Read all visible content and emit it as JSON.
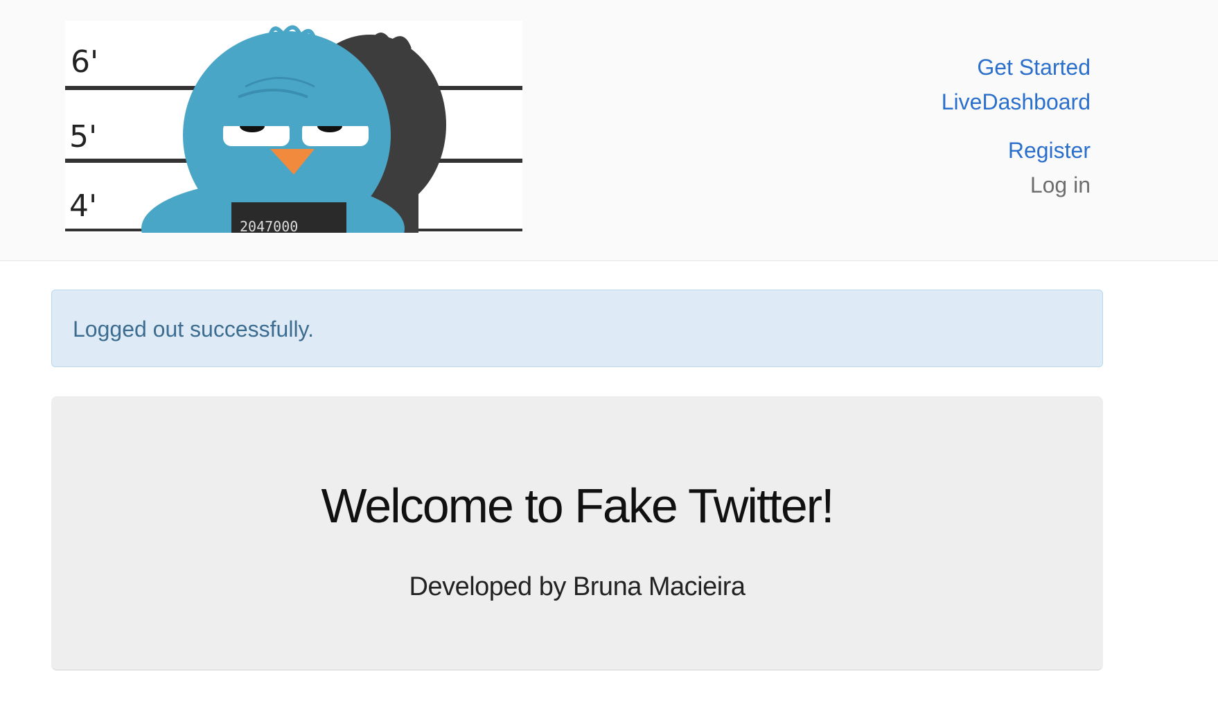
{
  "header": {
    "logo": {
      "alt": "Fake Twitter mugshot bird logo",
      "height_marks": [
        "6'",
        "5'",
        "4'"
      ],
      "placard_text": "2047000"
    },
    "nav": {
      "get_started": "Get Started",
      "live_dashboard": "LiveDashboard",
      "register": "Register",
      "login": "Log in"
    }
  },
  "flash": {
    "info": "Logged out successfully."
  },
  "hero": {
    "title": "Welcome to Fake Twitter!",
    "subtitle": "Developed by Bruna Macieira"
  },
  "colors": {
    "link": "#2b6fcc",
    "muted_link": "#6d6d6d",
    "alert_bg": "#deebf6",
    "alert_text": "#3c6c8f",
    "hero_bg": "#eeeeee",
    "bird_blue": "#4aa6c7",
    "beak": "#f28a3d"
  }
}
